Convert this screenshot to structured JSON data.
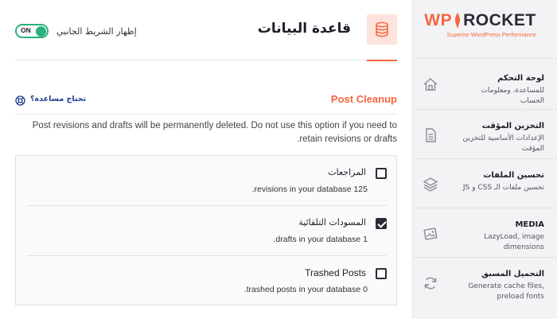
{
  "brand": {
    "logo_wp": "WP",
    "logo_rocket": "ROCKET",
    "tagline": "Superior WordPress Performance",
    "accent_color": "#f56640"
  },
  "sidebar": {
    "items": [
      {
        "title": "لوحة التحكم",
        "desc": "للمساعدة، ومعلومات الحساب",
        "icon": "home-icon"
      },
      {
        "title": "التخزين المؤقت",
        "desc": "الإعدادات الأساسية للتخزين المؤقت",
        "icon": "document-icon"
      },
      {
        "title": "تحسين الملفات",
        "desc": "تحسين ملفات الـ CSS و JS",
        "icon": "layers-icon"
      },
      {
        "title": "MEDIA",
        "desc": "LazyLoad, image dimensions",
        "icon": "image-icon"
      },
      {
        "title": "التحميل المسبق",
        "desc": "Generate cache files, preload fonts",
        "icon": "refresh-icon"
      }
    ]
  },
  "header": {
    "title": "قاعدة البيانات",
    "icon": "database-icon",
    "sidebar_toggle_label": "إظهار الشريط الجانبي",
    "toggle_state": "ON",
    "toggle_color": "#2ab27b"
  },
  "section": {
    "title": "Post Cleanup",
    "help_text": "تحتاج مساعدة؟",
    "help_icon": "lifebuoy-icon",
    "warning": "Post revisions and drafts will be permanently deleted. Do not use this option if you need to retain revisions or drafts."
  },
  "options": [
    {
      "label": "المراجعات",
      "desc": "125 revisions in your database.",
      "checked": false
    },
    {
      "label": "المسودات التلقائية",
      "desc": "1 drafts in your database.",
      "checked": true
    },
    {
      "label": "Trashed Posts",
      "desc": "0 trashed posts in your database.",
      "checked": false
    }
  ]
}
